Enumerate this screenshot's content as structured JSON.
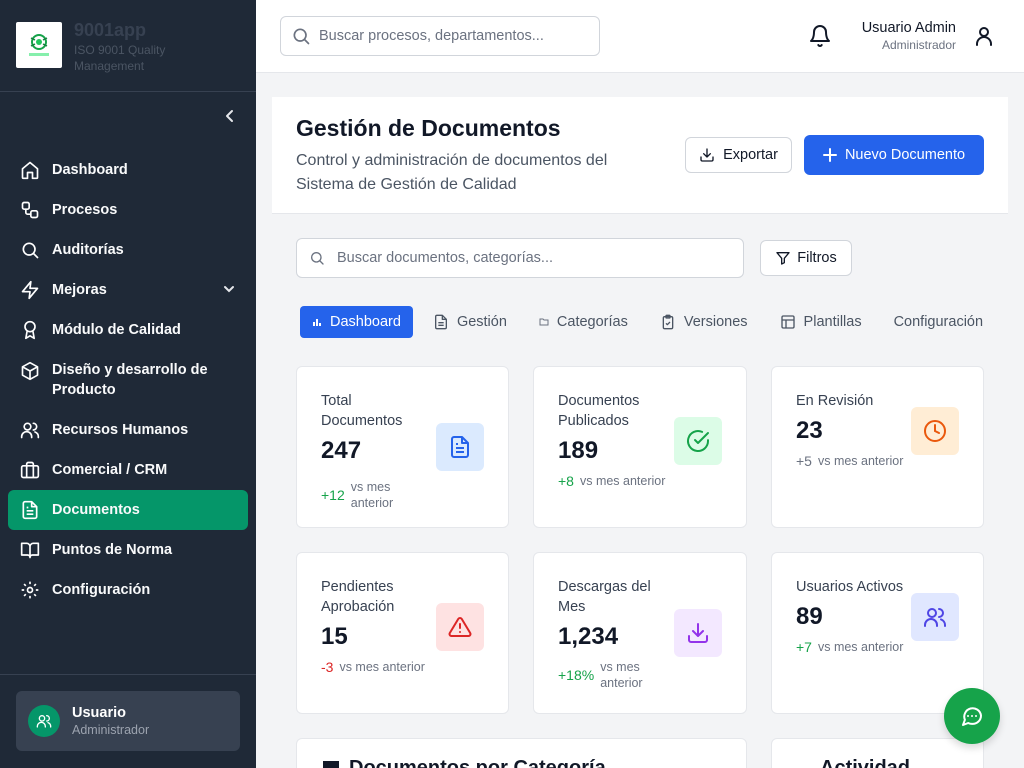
{
  "brand": {
    "name": "9001app",
    "subtitle": "ISO 9001 Quality Management"
  },
  "sidebar": {
    "items": [
      {
        "label": "Dashboard",
        "icon": "home-icon"
      },
      {
        "label": "Procesos",
        "icon": "workflow-icon"
      },
      {
        "label": "Auditorías",
        "icon": "search-icon"
      },
      {
        "label": "Mejoras",
        "icon": "zap-icon",
        "has_submenu": true
      },
      {
        "label": "Módulo de Calidad",
        "icon": "award-icon"
      },
      {
        "label": "Diseño y desarrollo de Producto",
        "icon": "package-icon"
      },
      {
        "label": "Recursos Humanos",
        "icon": "users-icon"
      },
      {
        "label": "Comercial / CRM",
        "icon": "briefcase-icon"
      },
      {
        "label": "Documentos",
        "icon": "file-text-icon",
        "active": true
      },
      {
        "label": "Puntos de Norma",
        "icon": "book-open-icon"
      },
      {
        "label": "Configuración",
        "icon": "gear-icon"
      }
    ],
    "footer_user": {
      "name": "Usuario",
      "role": "Administrador"
    }
  },
  "header": {
    "search_placeholder": "Buscar procesos, departamentos...",
    "user_name": "Usuario Admin",
    "user_role": "Administrador"
  },
  "page": {
    "title": "Gestión de Documentos",
    "subtitle": "Control y administración de documentos del Sistema de Gestión de Calidad",
    "export_label": "Exportar",
    "new_label": "Nuevo Documento"
  },
  "filters": {
    "search_placeholder": "Buscar documentos, categorías...",
    "filter_label": "Filtros"
  },
  "tabs": [
    {
      "label": "Dashboard",
      "active": true
    },
    {
      "label": "Gestión"
    },
    {
      "label": "Categorías"
    },
    {
      "label": "Versiones"
    },
    {
      "label": "Plantillas"
    },
    {
      "label": "Configuración"
    }
  ],
  "stats": [
    {
      "title": "Total Documentos",
      "value": "247",
      "change": "+12",
      "period": "vs mes anterior",
      "trend": "up",
      "icon": "file-text-icon",
      "accent": "#2563eb",
      "bg": "#dbeafe"
    },
    {
      "title": "Documentos Publicados",
      "value": "189",
      "change": "+8",
      "period": "vs mes anterior",
      "trend": "up",
      "icon": "check-circle-icon",
      "accent": "#16a34a",
      "bg": "#dcfce7"
    },
    {
      "title": "En Revisión",
      "value": "23",
      "change": "+5",
      "period": "vs mes anterior",
      "trend": "neutral",
      "icon": "clock-icon",
      "accent": "#ea580c",
      "bg": "#ffedd5"
    },
    {
      "title": "Pendientes Aprobación",
      "value": "15",
      "change": "-3",
      "period": "vs mes anterior",
      "trend": "down",
      "icon": "alert-triangle-icon",
      "accent": "#dc2626",
      "bg": "#fee2e2"
    },
    {
      "title": "Descargas del Mes",
      "value": "1,234",
      "change": "+18%",
      "period": "vs mes anterior",
      "trend": "up",
      "icon": "download-icon",
      "accent": "#9333ea",
      "bg": "#f3e8ff"
    },
    {
      "title": "Usuarios Activos",
      "value": "89",
      "change": "+7",
      "period": "vs mes anterior",
      "trend": "up",
      "icon": "users-icon",
      "accent": "#4f46e5",
      "bg": "#e0e7ff"
    }
  ],
  "sections": [
    {
      "title": "Documentos por Categoría"
    },
    {
      "title": "Actividad"
    }
  ]
}
